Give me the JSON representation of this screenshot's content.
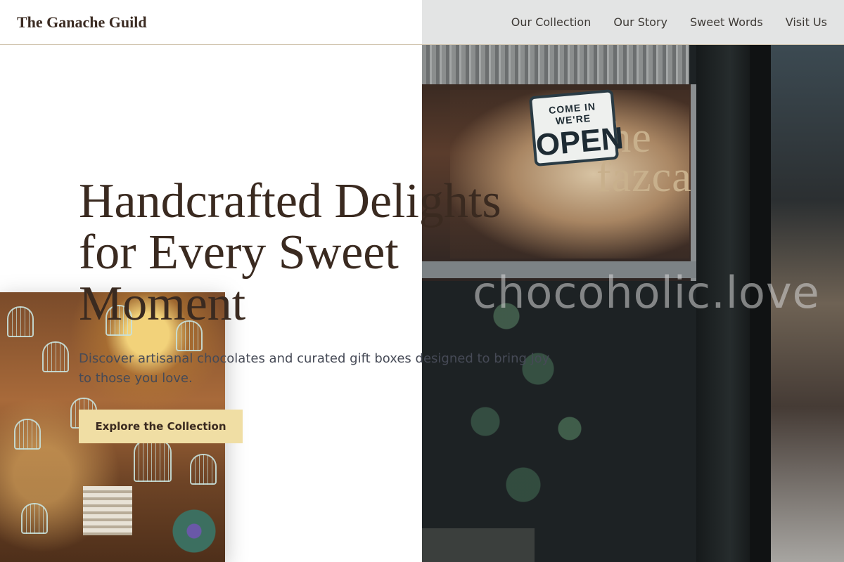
{
  "brand": {
    "name": "The Ganache Guild"
  },
  "nav": {
    "items": [
      {
        "label": "Our Collection"
      },
      {
        "label": "Our Story"
      },
      {
        "label": "Sweet Words"
      },
      {
        "label": "Visit Us"
      }
    ]
  },
  "hero": {
    "title": "Handcrafted Delights for Every Sweet Moment",
    "subtitle": "Discover artisanal chocolates and curated gift boxes designed to bring joy to those you love.",
    "cta_label": "Explore the Collection"
  },
  "photo": {
    "sign_small": "COME IN WE'RE",
    "sign_big": "OPEN",
    "shop_sign": "the\nfazca",
    "watermark": "chocoholic.love"
  },
  "colors": {
    "heading": "#3a2a20",
    "cta_background": "#f0dea4",
    "body_text": "#464a56"
  }
}
